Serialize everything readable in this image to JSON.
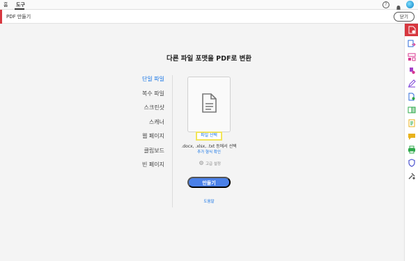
{
  "nav": {
    "home": "홈",
    "tools": "도구",
    "help_icon_text": "?"
  },
  "toolbar": {
    "title": "PDF 만들기",
    "close_label": "닫기"
  },
  "main": {
    "heading": "다른 파일 포맷을 PDF로 변환",
    "options": [
      {
        "label": "단일 파일",
        "selected": true
      },
      {
        "label": "복수 파일",
        "selected": false
      },
      {
        "label": "스크린샷",
        "selected": false
      },
      {
        "label": "스캐너",
        "selected": false
      },
      {
        "label": "웹 페이지",
        "selected": false
      },
      {
        "label": "클립보드",
        "selected": false
      },
      {
        "label": "빈 페이지",
        "selected": false
      }
    ],
    "select_file": "파일 선택",
    "hint": ".docx, .xlsx, .txt 등에서 선택",
    "more_formats": "추가 형식 확인",
    "advanced": "고급 설정",
    "create": "만들기",
    "help_link": "도움말"
  },
  "rail": {
    "items": [
      {
        "icon": "create-pdf-icon",
        "color": "#ffffff"
      },
      {
        "icon": "export-pdf-icon",
        "color": "#2d6ad8"
      },
      {
        "icon": "organize-pages-icon",
        "color": "#d83790"
      },
      {
        "icon": "comment-icon",
        "color": "#a340c8"
      },
      {
        "icon": "fill-sign-icon",
        "color": "#7a3ed6"
      },
      {
        "icon": "scan-ocr-icon",
        "color": "#2ea84a"
      },
      {
        "icon": "compare-icon",
        "color": "#2ea84a"
      },
      {
        "icon": "edit-pdf-icon",
        "color": "#e8b21c"
      },
      {
        "icon": "comments-icon",
        "color": "#e8b21c"
      },
      {
        "icon": "print-production-icon",
        "color": "#2ea84a"
      },
      {
        "icon": "protect-icon",
        "color": "#4a52cf"
      },
      {
        "icon": "more-tools-icon",
        "color": "#555555"
      }
    ]
  },
  "colors": {
    "accent": "#d7373f",
    "link": "#1473e6",
    "primary_button": "#4a80e8",
    "highlight": "#f2e55a"
  }
}
